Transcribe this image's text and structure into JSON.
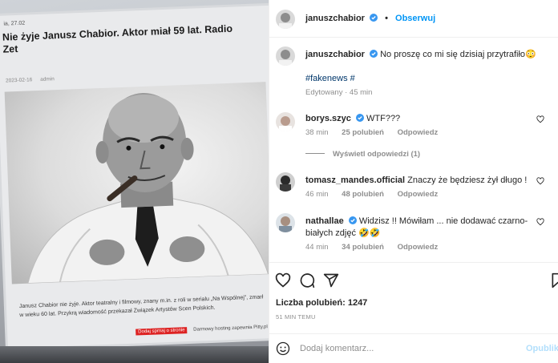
{
  "photo": {
    "screen_date": "ia, 27.02",
    "headline": "Nie żyje Janusz Chabior. Aktor miał 59 lat. Radio Zet",
    "meta_date": "2023-02-16",
    "meta_author": "admin",
    "caption": "Janusz Chabior nie żyje. Aktor teatralny i filmowy, znany m.in. z roli w serialu „Na Wspólnej”, zmarł w wieku 60 lat. Przykrą wiadomość przekazał Związek Artystów Scen Polskich.",
    "ad_red": "Dodaj sprnaj o stronie",
    "ad_text": "Darmowy hosting zapewnia Pitty.pl"
  },
  "header": {
    "username": "januszchabior",
    "dot": "•",
    "follow_label": "Obserwuj"
  },
  "post": {
    "username": "januszchabior",
    "text": "No proszę co mi się dzisiaj przytrafiło😳",
    "hashtags": "#fakenews #",
    "edited": "Edytowany · 45 min"
  },
  "comments": [
    {
      "username": "borys.szyc",
      "text": "WTF???",
      "time": "38 min",
      "likes": "25 polubień",
      "reply": "Odpowiedz"
    },
    {
      "username": "tomasz_mandes.official",
      "text": "Znaczy że będziesz żył długo !",
      "time": "46 min",
      "likes": "48 polubień",
      "reply": "Odpowiedz"
    },
    {
      "username": "nathallae",
      "text": "Widzisz !! Mówiłam ... nie dodawać czarno-białych zdjęć 🤣🤣",
      "time": "44 min",
      "likes": "34 polubień",
      "reply": "Odpowiedz"
    }
  ],
  "view_replies": "Wyświetl odpowiedzi (1)",
  "actions": {
    "likes_text": "Liczba polubień: 1247",
    "time_ago": "51 MIN TEMU"
  },
  "comment_box": {
    "placeholder": "Dodaj komentarz...",
    "publish_label": "Opublikuj"
  },
  "icons": {
    "like": "heart-icon",
    "comment": "comment-icon",
    "share": "share-icon",
    "save": "bookmark-icon",
    "emoji": "emoji-icon",
    "verified": "verified-badge-icon"
  },
  "colors": {
    "accent": "#0095f6",
    "verified": "#3897f0",
    "muted": "#8e8e8e",
    "hashtag": "#00376b"
  }
}
